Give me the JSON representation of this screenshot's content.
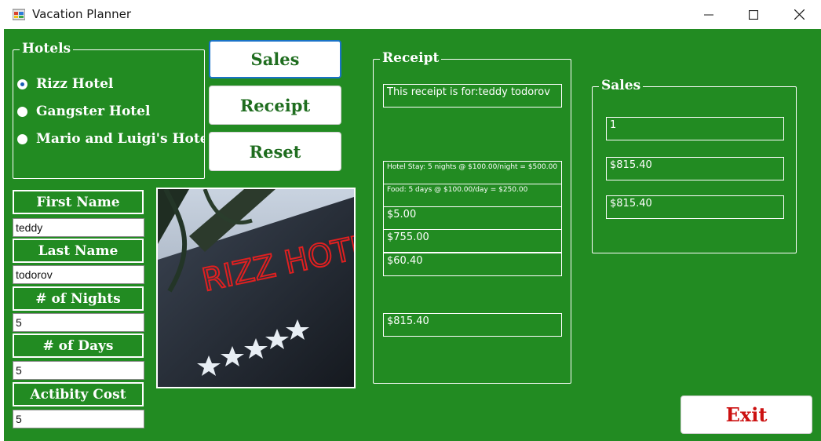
{
  "window": {
    "title": "Vacation Planner",
    "controls": {
      "minimize": "—",
      "maximize": "☐",
      "close": "✕"
    }
  },
  "hotels_group": {
    "title": "Hotels",
    "options": [
      {
        "label": "Rizz Hotel",
        "checked": true
      },
      {
        "label": "Gangster Hotel",
        "checked": false
      },
      {
        "label": "Mario and Luigi's Hotel",
        "checked": false
      }
    ]
  },
  "buttons": {
    "sales": "Sales",
    "receipt": "Receipt",
    "reset": "Reset",
    "exit": "Exit"
  },
  "form": {
    "first_name_label": "First Name",
    "first_name_value": "teddy",
    "last_name_label": "Last Name",
    "last_name_value": "todorov",
    "nights_label": "# of Nights",
    "nights_value": "5",
    "days_label": "# of Days",
    "days_value": "5",
    "activity_label": "Actibity Cost",
    "activity_value": "5"
  },
  "image": {
    "caption": "RIZZ HOTEL"
  },
  "receipt": {
    "title": "Receipt",
    "for_line": "This receipt is for:teddy todorov",
    "hotel_line": "Hotel Stay: 5 nights @ $100.00/night = $500.00",
    "food_line": "Food: 5 days @ $100.00/day = $250.00",
    "activity": "$5.00",
    "subtotal": "$755.00",
    "tax": "$60.40",
    "total": "$815.40"
  },
  "sales": {
    "title": "Sales",
    "count": "1",
    "amount1": "$815.40",
    "amount2": "$815.40"
  },
  "colors": {
    "background": "#228b22",
    "button_text": "#1f6d1f",
    "exit_text": "#cc1111",
    "radio_selected": "#1a5fb4"
  }
}
